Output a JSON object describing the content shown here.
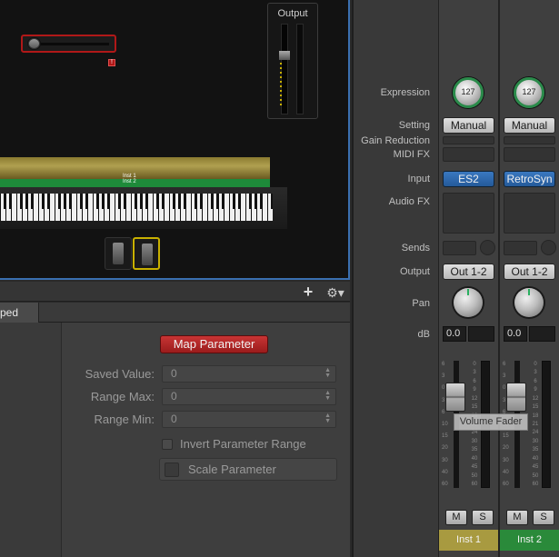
{
  "canvas": {
    "output_title": "Output",
    "inst1_label": "Inst 1",
    "inst2_label": "Inst 2"
  },
  "inspector": {
    "tab_label": "ped",
    "map_button": "Map Parameter",
    "fields": [
      {
        "label": "Saved Value:",
        "value": "0"
      },
      {
        "label": "Range Max:",
        "value": "0"
      },
      {
        "label": "Range Min:",
        "value": "0"
      }
    ],
    "invert_label": "Invert Parameter Range",
    "scale_label": "Scale Parameter"
  },
  "mixer": {
    "labels": {
      "expression": "Expression",
      "setting": "Setting",
      "gain_reduction": "Gain Reduction",
      "midi_fx": "MIDI FX",
      "input": "Input",
      "audio_fx": "Audio FX",
      "sends": "Sends",
      "output": "Output",
      "pan": "Pan",
      "db": "dB"
    },
    "strips": [
      {
        "expression": "127",
        "setting": "Manual",
        "input": "ES2",
        "output": "Out 1-2",
        "db": "0.0",
        "mute": "M",
        "solo": "S",
        "name": "Inst 1"
      },
      {
        "expression": "127",
        "setting": "Manual",
        "input": "RetroSyn",
        "output": "Out 1-2",
        "db": "0.0",
        "mute": "M",
        "solo": "S",
        "name": "Inst 2"
      }
    ],
    "fader_scale": [
      "6",
      "3",
      "0",
      "3",
      "6",
      "10",
      "15",
      "20",
      "30",
      "40",
      "60"
    ],
    "meter_scale": [
      "0",
      "3",
      "6",
      "9",
      "12",
      "15",
      "18",
      "21",
      "24",
      "30",
      "35",
      "40",
      "45",
      "50",
      "60"
    ],
    "tooltip": "Volume Fader"
  },
  "colors": {
    "accent_red": "#b01818",
    "input_blue": "#3a78c0",
    "inst1_color": "#a89a40",
    "inst2_color": "#2a8a3a",
    "knob_ring": "#2a8a4a"
  }
}
